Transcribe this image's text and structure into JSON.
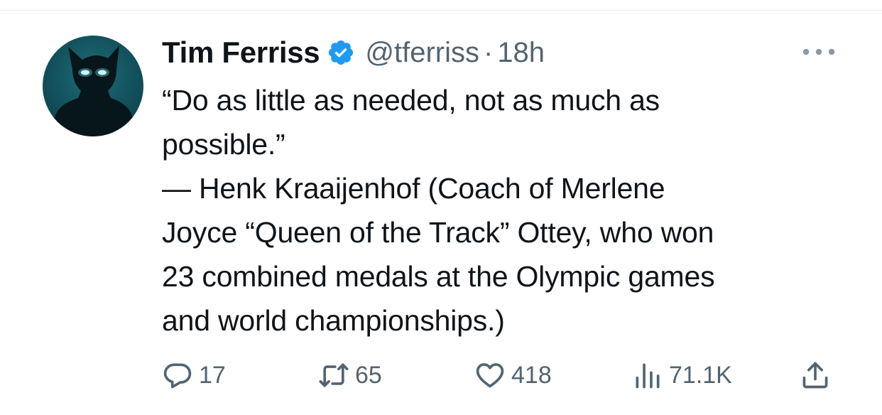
{
  "tweet": {
    "author": {
      "display_name": "Tim Ferriss",
      "handle": "@tferriss",
      "verified": true
    },
    "separator": "·",
    "time": "18h",
    "text": "“Do as little as needed, not as much as\npossible.”\n— Henk Kraaijenhof (Coach of Merlene\nJoyce “Queen of the Track” Ottey, who won\n23 combined medals at the Olympic games\nand world championships.)",
    "stats": {
      "replies": "17",
      "retweets": "65",
      "likes": "418",
      "views": "71.1K"
    }
  },
  "icons": {
    "more": "more-horizontal-icon",
    "reply": "reply-icon",
    "retweet": "retweet-icon",
    "like": "heart-icon",
    "views": "views-icon",
    "share": "share-icon",
    "verified": "verified-badge-icon"
  },
  "colors": {
    "text_primary": "#0f1419",
    "text_secondary": "#536471",
    "verified_blue": "#1d9bf0",
    "divider": "#e6e9ec"
  }
}
